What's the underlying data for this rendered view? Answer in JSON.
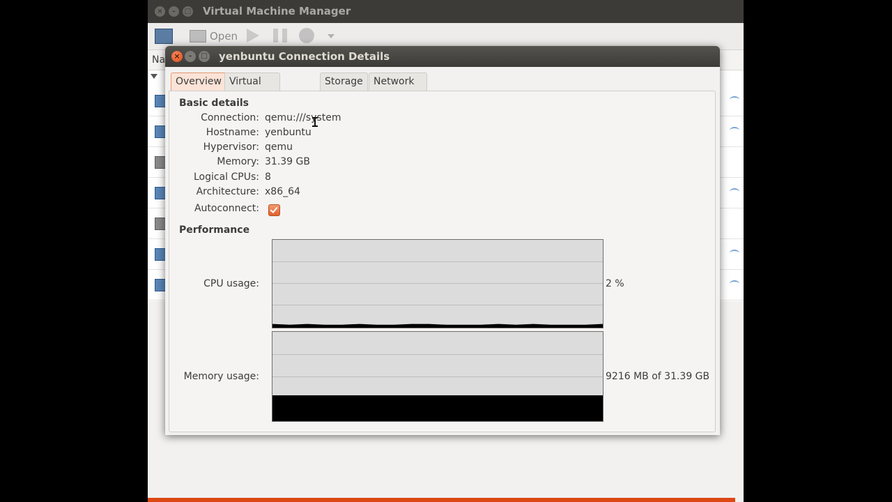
{
  "main_window": {
    "title": "Virtual Machine Manager",
    "toolbar": {
      "open_label": "Open"
    },
    "list_header": "Na",
    "vm_rows": [
      {
        "state": "running"
      },
      {
        "state": "running"
      },
      {
        "state": "off"
      },
      {
        "state": "running"
      },
      {
        "state": "off"
      },
      {
        "state": "running"
      },
      {
        "state": "running"
      }
    ]
  },
  "dialog": {
    "title": "yenbuntu Connection Details",
    "tabs": [
      {
        "label": "Overview",
        "active": true
      },
      {
        "label": "Virtual Networks",
        "active": false
      },
      {
        "label": "Storage",
        "active": false
      },
      {
        "label": "Network Interfaces",
        "active": false
      }
    ],
    "basic_details": {
      "heading": "Basic details",
      "fields": [
        {
          "label": "Connection:",
          "value": "qemu:///system"
        },
        {
          "label": "Hostname:",
          "value": "yenbuntu"
        },
        {
          "label": "Hypervisor:",
          "value": "qemu"
        },
        {
          "label": "Memory:",
          "value": "31.39 GB"
        },
        {
          "label": "Logical CPUs:",
          "value": "8"
        },
        {
          "label": "Architecture:",
          "value": "x86_64"
        }
      ],
      "autoconnect_label": "Autoconnect:",
      "autoconnect_checked": true
    },
    "performance": {
      "heading": "Performance",
      "cpu_label": "CPU usage:",
      "cpu_value": "2 %",
      "memory_label": "Memory usage:",
      "memory_value": "9216 MB of 31.39 GB",
      "memory_fraction": 0.29,
      "cpu_history": [
        0.02,
        0.01,
        0.02,
        0.01,
        0.01,
        0.02,
        0.01,
        0.01,
        0.02,
        0.02,
        0.01,
        0.01,
        0.01,
        0.02,
        0.01,
        0.02,
        0.01,
        0.01,
        0.01,
        0.02
      ]
    }
  },
  "colors": {
    "accent_orange": "#dd4814",
    "titlebar_dark": "#3c3b37",
    "graph_bg": "#dcdcdc",
    "graph_fill": "#000000"
  }
}
